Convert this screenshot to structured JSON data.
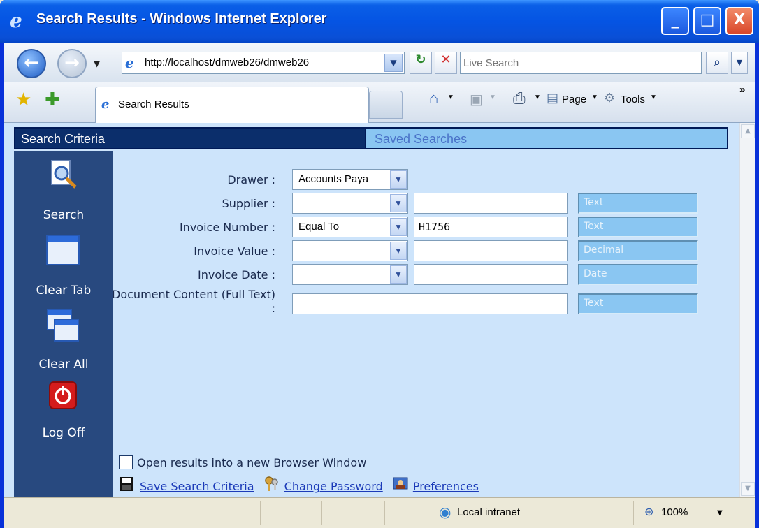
{
  "window": {
    "title": "Search Results - Windows Internet Explorer",
    "minimize": "_",
    "maximize": "□",
    "close": "X"
  },
  "nav": {
    "back_label": "←",
    "forward_label": "→",
    "address": "http://localhost/dmweb26/dmweb26",
    "refresh_label": "↻",
    "stop_label": "✕",
    "search_placeholder": "Live Search",
    "search_icon": "search-icon"
  },
  "tabs": {
    "active_tab": "Search Results",
    "commands": {
      "home": "⌂",
      "feeds": "▣",
      "print": "⎙",
      "page": "Page",
      "tools": "Tools",
      "more": "»"
    }
  },
  "panel": {
    "criteria_tab": "Search Criteria",
    "saved_tab": "Saved Searches"
  },
  "sidebar": {
    "items": [
      {
        "label": "Search",
        "icon": "magnifier-document-icon"
      },
      {
        "label": "Clear Tab",
        "icon": "window-icon"
      },
      {
        "label": "Clear All",
        "icon": "windows-stack-icon"
      },
      {
        "label": "Log Off",
        "icon": "power-icon"
      }
    ]
  },
  "form": {
    "rows": [
      {
        "label": "Drawer :",
        "operator": "Accounts Paya",
        "value": "",
        "type": ""
      },
      {
        "label": "Supplier :",
        "operator": "",
        "value": "",
        "type": "Text"
      },
      {
        "label": "Invoice Number :",
        "operator": "Equal To",
        "value": "H1756",
        "type": "Text"
      },
      {
        "label": "Invoice Value :",
        "operator": "",
        "value": "",
        "type": "Decimal"
      },
      {
        "label": "Invoice Date :",
        "operator": "",
        "value": "",
        "type": "Date"
      },
      {
        "label": "Document Content (Full Text) :",
        "operator": "",
        "value": "",
        "type": "Text"
      }
    ],
    "open_new_window_label": "Open results into a new Browser Window",
    "open_new_window_checked": false,
    "links": {
      "save": "Save Search Criteria",
      "password": "Change Password",
      "preferences": "Preferences"
    }
  },
  "status": {
    "zone": "Local intranet",
    "zoom": "100%"
  },
  "colors": {
    "titlebar": "#0554e3",
    "sidebar": "#28497f",
    "content_bg": "#cde4fb",
    "header_dark": "#0b2e6b",
    "saved_tab_bg": "#8ac6f2",
    "type_badge_bg": "#8ac6f2",
    "link": "#1b3ab8"
  }
}
